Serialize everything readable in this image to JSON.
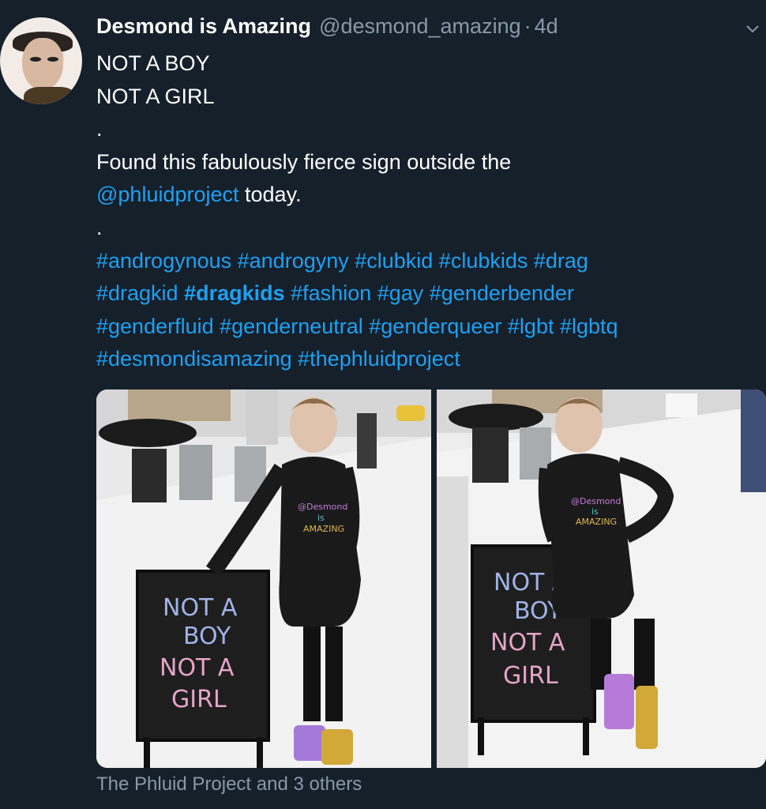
{
  "tweet": {
    "author_name": "Desmond is Amazing",
    "handle": "@desmond_amazing",
    "separator": "·",
    "age": "4d",
    "lines": {
      "line1": "NOT A BOY",
      "line2": "NOT A GIRL",
      "dot1": ".",
      "found_text": "Found this fabulously fierce sign outside the",
      "mention": "@phluidproject",
      "mention_suffix": " today.",
      "dot2": "."
    },
    "hashtags": {
      "row1": "#androgynous #androgyny #clubkid #clubkids #drag",
      "row2a": "#dragkid ",
      "row2b": "#dragkids",
      "row2c": "  #fashion #gay #genderbender",
      "row3": "#genderfluid #genderneutral #genderqueer #lgbt #lgbtq",
      "row4": "#desmondisamazing #thephluidproject"
    },
    "photo_left": {
      "sign_text": [
        "NOT A",
        "BOY",
        "NOT A",
        "GIRL"
      ],
      "shirt_text": [
        "@Desmond",
        "is",
        "AMAZING"
      ]
    },
    "photo_right": {
      "sign_text": [
        "NOT A",
        "BOY",
        "NOT A",
        "GIRL"
      ],
      "shirt_text": [
        "@Desmond",
        "is",
        "AMAZING"
      ]
    },
    "tagged": "The Phluid Project and 3 others"
  },
  "colors": {
    "background": "#15202b",
    "link": "#1da1f2",
    "muted": "#8899a6"
  },
  "icons": {
    "chevron": "chevron-down-icon",
    "avatar": "avatar"
  }
}
